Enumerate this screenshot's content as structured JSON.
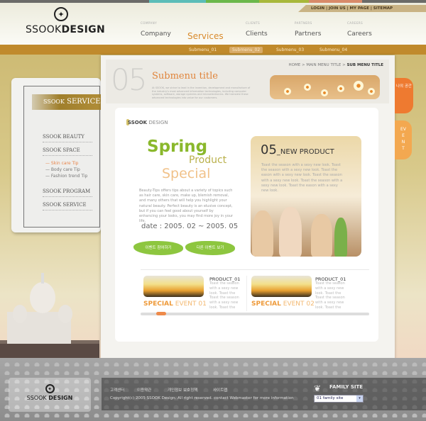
{
  "brand": {
    "logo_prefix": "SSOOK",
    "logo_suffix": "DESIGN"
  },
  "utility": {
    "text": "LOGIN | JOIN US | MY PAGE | SITEMAP"
  },
  "nav": [
    {
      "small": "COMPANY",
      "label": "Company"
    },
    {
      "small": "",
      "label": "Services"
    },
    {
      "small": "CLIENTS",
      "label": "Clients"
    },
    {
      "small": "PARTNERS",
      "label": "Partners"
    },
    {
      "small": "CAREERS",
      "label": "Careers"
    }
  ],
  "submenu": [
    "Submenu_01",
    "Submenu_02",
    "Submenu_03",
    "Submenu_04"
  ],
  "sidebar": {
    "title_prefix": "SSOOK",
    "title_suffix": "SERVICE",
    "items": [
      "SSOOK BEAUTY",
      "SSOOK SPACE",
      "SSOOK PROGRAM",
      "SSOOK SERVICE"
    ],
    "subitems": [
      "— Skin care Tip",
      "— Body care Tip",
      "— Fashion trend Tip"
    ]
  },
  "page": {
    "breadcrumb_path": "HOME > MAIN MENU TITLE > ",
    "breadcrumb_current": "SUB MENU TITLE",
    "number": "05",
    "title": "Submenu title",
    "description": "At SSOOK, we strive to lead in the invention, development and manufacture of the industry's most advanced information technologies, including computer systems, software, storage systems and microelectronics. We translate these advanced technologies into value for our customers."
  },
  "content": {
    "section_bold": "SSOOK",
    "section_light": "DESIGN",
    "spring": "Spring",
    "product": "Product",
    "special": "Special",
    "body": "Beauty-Tips offers tips about a variety of topics such as hair care, skin care, make up, blemish removal, and many others that will help you highlight your natural beauty. Perfect beauty is an elusive concept, but if you can feel good about yourself by enhancing your looks, you may find more joy in your life.",
    "date": "date : 2005. 02 ~ 2005. 05",
    "btn_join": "이벤트 참여하기",
    "btn_other": "다른 이벤트 보기",
    "np_number": "05",
    "np_title": "_NEW PRODUCT",
    "np_desc": "Toast the season with a sexy new look. Toast the season with a sexy new look. Toast the eason with a sexy new look. Toast the season with a sexy new look. Toast the season with a sexy new look. Toast the eason with a sexy new look."
  },
  "events": [
    {
      "bold": "SPECIAL",
      "light": "EVENT 01",
      "title": "PRODUCT_01",
      "desc": "Toast the season with a sexy new look. Toast the Toast the season with a sexy new look. Toast the"
    },
    {
      "bold": "SPECIAL",
      "light": "EVENT 02",
      "title": "PRODUCT_01",
      "desc": "Toast the season with a sexy new look. Toast the Toast the season with a sexy new look. Toast the"
    }
  ],
  "side_tabs": [
    "나의 공간",
    "EVENT"
  ],
  "footer": {
    "links": [
      "고객센터",
      "이용약관",
      "개인정보 보호정책",
      "사이트맵"
    ],
    "copyright": "Copyright(c) 2005 SSOOK Design. All right reserved. contact Webmaster for more information",
    "family_title": "FAMILY SITE",
    "family_select": "01 family site"
  },
  "colors": {
    "accent": "#c08a2c",
    "orange": "#e0843a",
    "green": "#8ab82c"
  }
}
